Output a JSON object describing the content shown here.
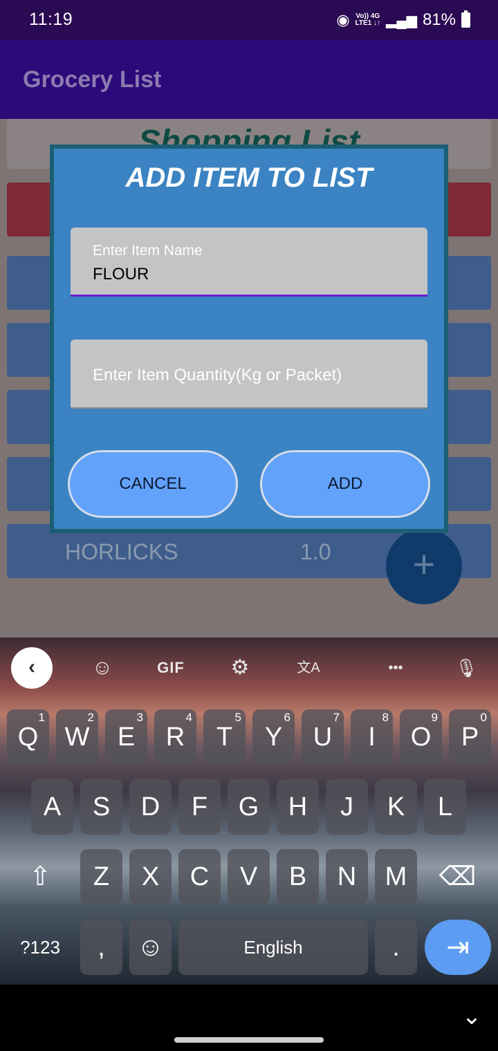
{
  "status_bar": {
    "time": "11:19",
    "net_top": "Vo)) 4G",
    "net_bottom": "LTE1 ↓↑",
    "battery": "81%"
  },
  "app_bar": {
    "title": "Grocery List"
  },
  "list": {
    "heading": "Shopping List",
    "last_item": {
      "name": "HORLICKS",
      "quantity": "1.0"
    },
    "fab_label": "+"
  },
  "dialog": {
    "title": "ADD ITEM TO LIST",
    "name_field": {
      "label": "Enter Item Name",
      "value": "FLOUR"
    },
    "quantity_field": {
      "placeholder": "Enter Item Quantity(Kg or Packet)",
      "value": ""
    },
    "cancel_label": "CANCEL",
    "add_label": "ADD"
  },
  "keyboard": {
    "toolbar": {
      "back": "‹",
      "sticker": "☺",
      "gif": "GIF",
      "settings": "⚙",
      "translate": "文A",
      "more": "•••",
      "mic": "🎙"
    },
    "row1": [
      {
        "key": "Q",
        "num": "1"
      },
      {
        "key": "W",
        "num": "2"
      },
      {
        "key": "E",
        "num": "3"
      },
      {
        "key": "R",
        "num": "4"
      },
      {
        "key": "T",
        "num": "5"
      },
      {
        "key": "Y",
        "num": "6"
      },
      {
        "key": "U",
        "num": "7"
      },
      {
        "key": "I",
        "num": "8"
      },
      {
        "key": "O",
        "num": "9"
      },
      {
        "key": "P",
        "num": "0"
      }
    ],
    "row2": [
      "A",
      "S",
      "D",
      "F",
      "G",
      "H",
      "J",
      "K",
      "L"
    ],
    "row3": [
      "Z",
      "X",
      "C",
      "V",
      "B",
      "N",
      "M"
    ],
    "shift": "⇧",
    "backspace": "⌫",
    "symbols": "?123",
    "comma": ",",
    "emoji": "☺",
    "space": "English",
    "period": ".",
    "enter": "⇥"
  },
  "nav": {
    "chevron": "⌄"
  }
}
